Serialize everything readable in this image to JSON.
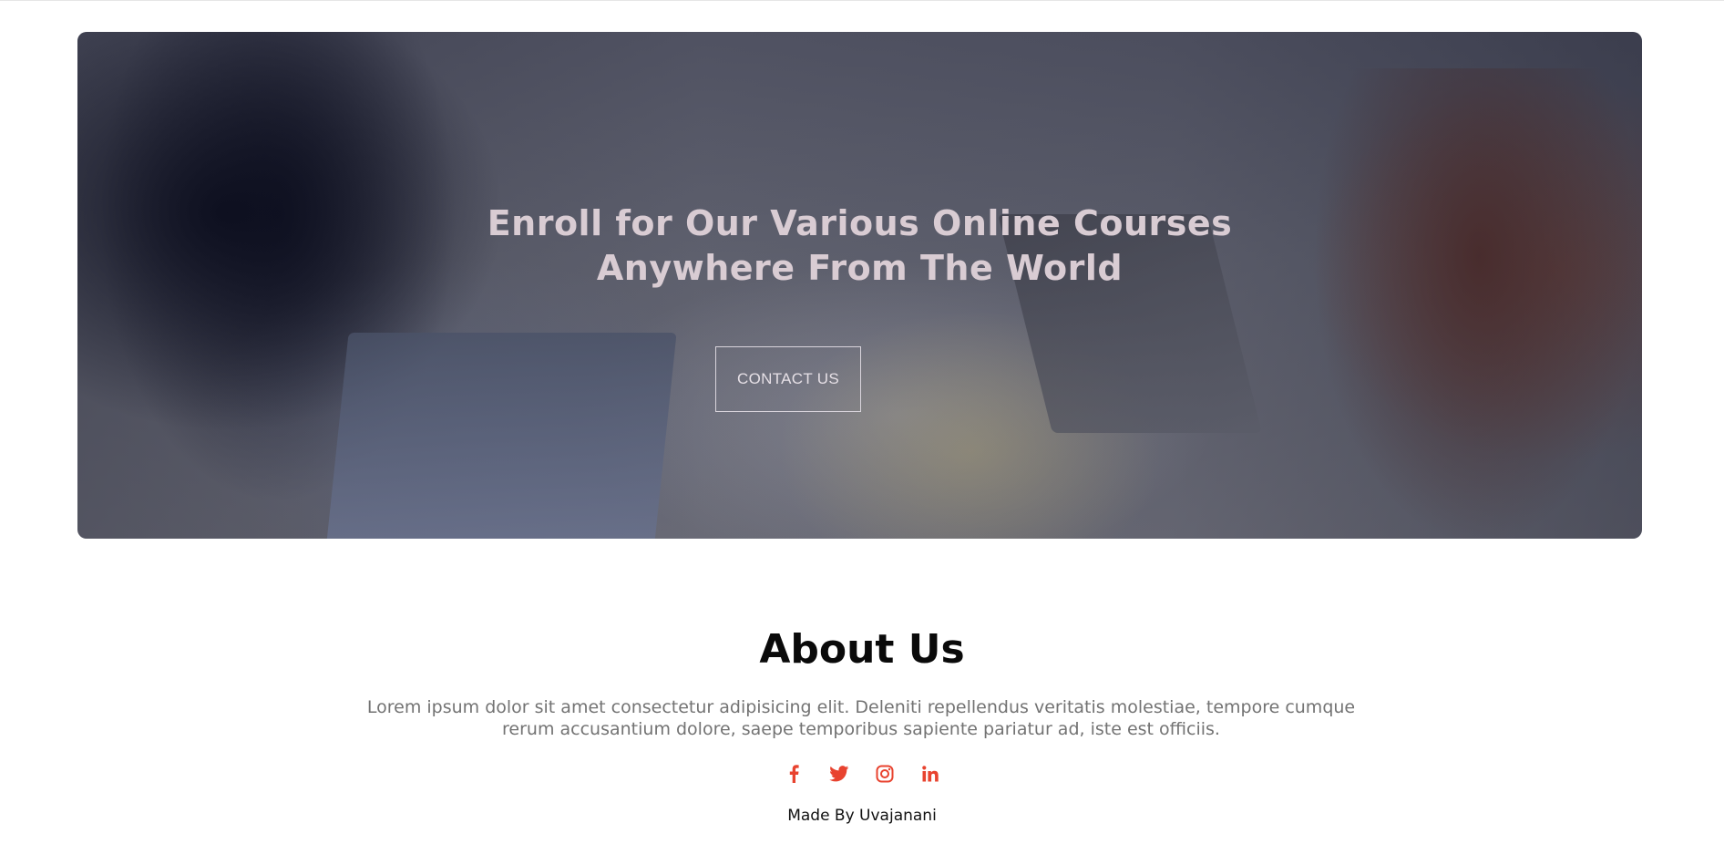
{
  "hero": {
    "title_line1": "Enroll for Our Various Online Courses",
    "title_line2": "Anywhere From The World",
    "button_label": "CONTACT US"
  },
  "about": {
    "title": "About Us",
    "text_line1": "Lorem ipsum dolor sit amet consectetur adipisicing elit. Deleniti repellendus veritatis molestiae, tempore cumque",
    "text_line2": "rerum accusantium dolore, saepe temporibus sapiente pariatur ad, iste est officiis."
  },
  "socials": [
    {
      "icon": "facebook-icon"
    },
    {
      "icon": "twitter-icon"
    },
    {
      "icon": "instagram-icon"
    },
    {
      "icon": "linkedin-icon"
    }
  ],
  "footer": {
    "credit": "Made By Uvajanani"
  },
  "colors": {
    "accent": "#e8432f",
    "hero_text": "#d9ccd3",
    "body_text": "#737373"
  }
}
